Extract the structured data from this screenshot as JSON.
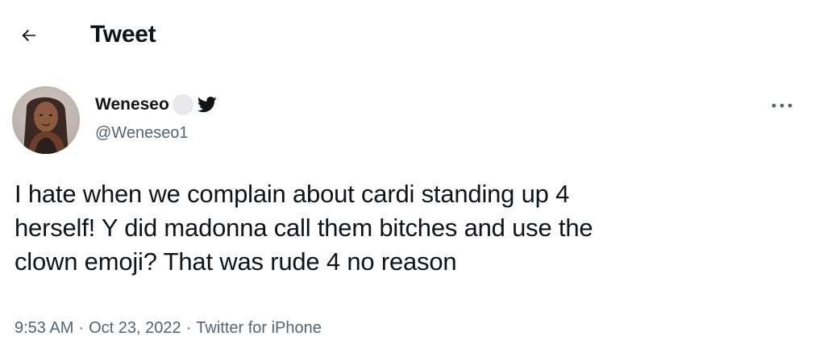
{
  "header": {
    "back_icon": "arrow-left-icon",
    "title": "Tweet"
  },
  "tweet": {
    "author": {
      "display_name": "Weneseo",
      "handle": "@Weneseo1",
      "badge_icon": "twitter-bird-icon"
    },
    "more_icon": "more-horizontal-icon",
    "text": "I hate when we complain about cardi standing up 4\nherself! Y did madonna call them bitches and use the\nclown emoji? That was rude 4 no reason",
    "time": "9:53 AM",
    "separator": "·",
    "date": "Oct 23, 2022",
    "source": "Twitter for iPhone"
  },
  "colors": {
    "text_primary": "#0f1419",
    "text_secondary": "#536471",
    "bird_blue": "#1d9bf0"
  }
}
